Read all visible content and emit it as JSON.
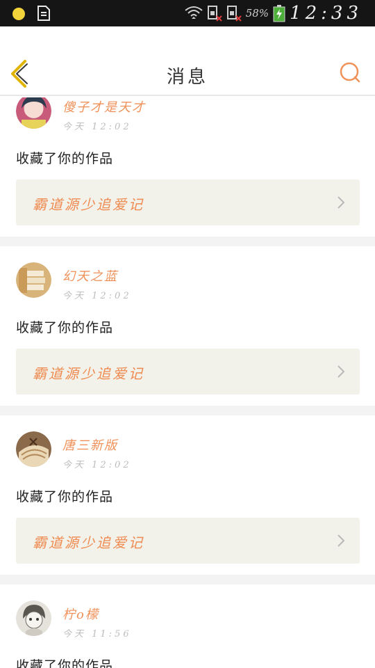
{
  "status_bar": {
    "battery_percent": "58%",
    "time": "12:33",
    "icons": [
      "notification-dot-icon",
      "document-icon",
      "wifi-icon",
      "sim1-no-signal-icon",
      "sim2-no-signal-icon",
      "battery-charging-icon"
    ]
  },
  "header": {
    "title": "消息",
    "back_icon": "chevron-left-icon",
    "search_icon": "search-icon"
  },
  "colors": {
    "accent": "#f0915a",
    "back_arrow": "#e0b400",
    "card_bg": "#f3f2ea"
  },
  "messages": [
    {
      "username": "傻子才是天才",
      "time": "今天 12:02",
      "action": "收藏了你的作品",
      "work_title": "霸道源少追爱记"
    },
    {
      "username": "幻天之蓝",
      "time": "今天 12:02",
      "action": "收藏了你的作品",
      "work_title": "霸道源少追爱记"
    },
    {
      "username": "唐三新版",
      "time": "今天 12:02",
      "action": "收藏了你的作品",
      "work_title": "霸道源少追爱记"
    },
    {
      "username": "柠o檬",
      "time": "今天 11:56",
      "action": "收藏了你的作品",
      "work_title": ""
    }
  ]
}
